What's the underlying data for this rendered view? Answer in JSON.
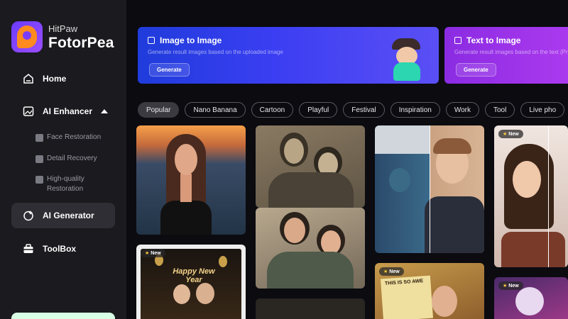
{
  "brand": {
    "line1": "HitPaw",
    "line2": "FotorPea"
  },
  "sidebar": {
    "items": [
      {
        "label": "Home"
      },
      {
        "label": "AI Enhancer"
      },
      {
        "label": "AI Generator"
      },
      {
        "label": "ToolBox"
      }
    ],
    "sub_items": [
      {
        "label": "Face Restoration"
      },
      {
        "label": "Detail Recovery"
      },
      {
        "label": "High-quality Restoration"
      }
    ]
  },
  "banners": [
    {
      "title": "Image to Image",
      "subtitle": "Generate result images based on the uploaded image",
      "button": "Generate"
    },
    {
      "title": "Text to Image",
      "subtitle": "Generate result images based on the text (Pr",
      "button": "Generate"
    }
  ],
  "tabs": [
    "Popular",
    "Nano Banana",
    "Cartoon",
    "Playful",
    "Festival",
    "Inspiration",
    "Work",
    "Tool",
    "Live pho"
  ],
  "badges": {
    "new": "New"
  },
  "card_text": {
    "party": "Happy New Year",
    "sign": "THIS IS SO AWE"
  },
  "colors": {
    "sidebar_bg": "#1a1a1f",
    "accent_blue": "#3b3ef2",
    "accent_purple": "#b03cf0",
    "active_nav": "#2e2e34"
  }
}
